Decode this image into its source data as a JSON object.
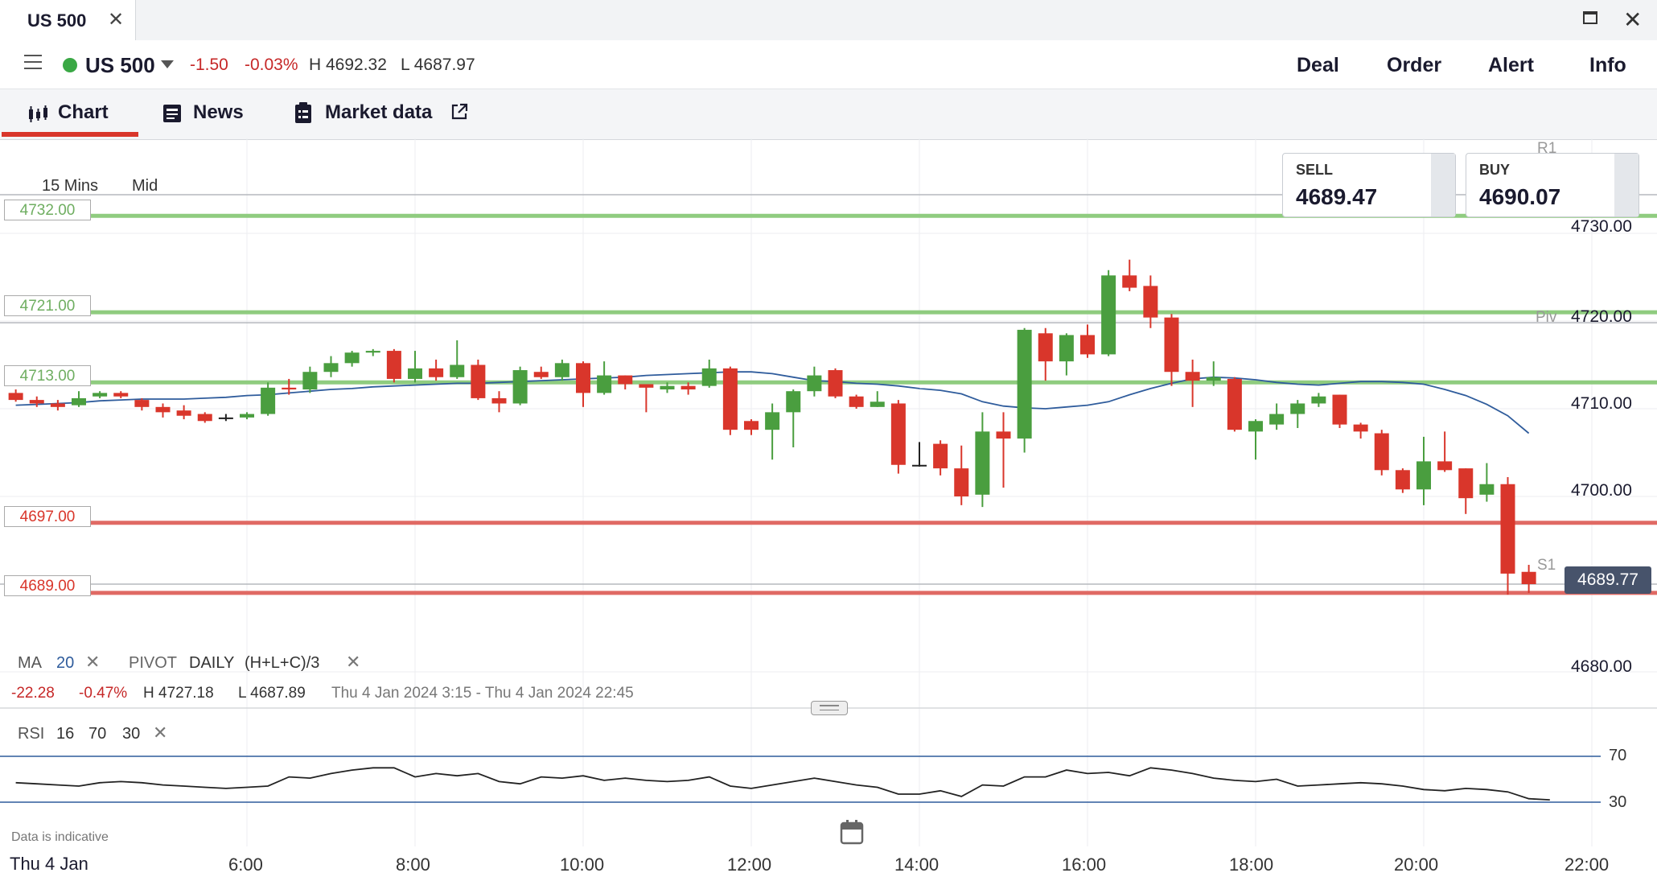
{
  "window": {
    "tab_title": "US 500"
  },
  "header": {
    "market": "US 500",
    "change": "-1.50",
    "change_pct": "-0.03%",
    "high": "H 4692.32",
    "low": "L 4687.97",
    "actions": [
      "Deal",
      "Order",
      "Alert",
      "Info"
    ]
  },
  "subtabs": {
    "chart": "Chart",
    "news": "News",
    "market_data": "Market data"
  },
  "chart": {
    "timeframe": "15 Mins",
    "price_type": "Mid",
    "sell_label": "SELL",
    "sell_price": "4689.47",
    "buy_label": "BUY",
    "buy_price": "4690.07",
    "current_price": "4689.77",
    "level_labels": [
      "4732.00",
      "4721.00",
      "4713.00",
      "4697.00",
      "4689.00"
    ],
    "pivot_labels": {
      "r1": "R1",
      "piv": "Piv",
      "s1": "S1"
    }
  },
  "legend": {
    "ma": "MA",
    "ma_period": "20",
    "pivot": "PIVOT",
    "pivot_period": "DAILY",
    "pivot_formula": "(H+L+C)/3",
    "range_change": "-22.28",
    "range_change_pct": "-0.47%",
    "range_high": "H 4727.18",
    "range_low": "L 4687.89",
    "range_dates": "Thu 4 Jan 2024 3:15 - Thu 4 Jan 2024 22:45",
    "rsi": "RSI",
    "rsi_period": "16",
    "rsi_upper": "70",
    "rsi_lower": "30"
  },
  "footer": {
    "date_start": "Thu 4 Jan",
    "indicative": "Data is indicative"
  },
  "colors": {
    "up": "#4a9e3f",
    "down": "#d9362b",
    "ma": "#2f5c9c",
    "support": "#e06a64",
    "resistance": "#8fcc7f"
  },
  "chart_data": {
    "type": "candlestick",
    "ylim": [
      4676,
      4738
    ],
    "y_ticks": [
      "4680.00",
      "4690.00",
      "4700.00",
      "4710.00",
      "4720.00",
      "4730.00"
    ],
    "x_ticks": [
      "6:00",
      "8:00",
      "10:00",
      "12:00",
      "14:00",
      "16:00",
      "18:00",
      "20:00",
      "22:00"
    ],
    "horizontal_levels": {
      "resistance": [
        4732,
        4721,
        4713
      ],
      "support": [
        4697,
        4689
      ],
      "pivot": {
        "R1": 4734.4,
        "Piv": 4719.8,
        "S1": 4690
      }
    },
    "candles": [
      {
        "o": 4711.8,
        "c": 4711.0,
        "h": 4712.2,
        "l": 4710.8
      },
      {
        "o": 4711.0,
        "c": 4710.6,
        "h": 4711.4,
        "l": 4710.2
      },
      {
        "o": 4710.6,
        "c": 4710.2,
        "h": 4711.0,
        "l": 4709.8
      },
      {
        "o": 4710.4,
        "c": 4711.2,
        "h": 4712.0,
        "l": 4710.2
      },
      {
        "o": 4711.4,
        "c": 4711.8,
        "h": 4712.0,
        "l": 4711.2
      },
      {
        "o": 4711.8,
        "c": 4711.4,
        "h": 4712.0,
        "l": 4711.2
      },
      {
        "o": 4711.0,
        "c": 4710.2,
        "h": 4711.2,
        "l": 4709.8
      },
      {
        "o": 4710.2,
        "c": 4709.6,
        "h": 4710.6,
        "l": 4709.0
      },
      {
        "o": 4709.8,
        "c": 4709.2,
        "h": 4710.4,
        "l": 4708.8
      },
      {
        "o": 4709.4,
        "c": 4708.6,
        "h": 4709.6,
        "l": 4708.4
      },
      {
        "o": 4709.0,
        "c": 4709.0,
        "h": 4709.4,
        "l": 4708.6
      },
      {
        "o": 4709.0,
        "c": 4709.4,
        "h": 4709.6,
        "l": 4708.8
      },
      {
        "o": 4709.4,
        "c": 4712.4,
        "h": 4713.0,
        "l": 4709.2
      },
      {
        "o": 4712.4,
        "c": 4712.2,
        "h": 4713.4,
        "l": 4711.6
      },
      {
        "o": 4712.2,
        "c": 4714.2,
        "h": 4714.8,
        "l": 4711.8
      },
      {
        "o": 4714.2,
        "c": 4715.2,
        "h": 4716.0,
        "l": 4713.6
      },
      {
        "o": 4715.2,
        "c": 4716.4,
        "h": 4716.6,
        "l": 4714.8
      },
      {
        "o": 4716.4,
        "c": 4716.6,
        "h": 4716.8,
        "l": 4716.0
      },
      {
        "o": 4716.6,
        "c": 4713.4,
        "h": 4716.8,
        "l": 4713.0
      },
      {
        "o": 4713.4,
        "c": 4714.6,
        "h": 4716.6,
        "l": 4713.0
      },
      {
        "o": 4714.6,
        "c": 4713.6,
        "h": 4715.6,
        "l": 4713.2
      },
      {
        "o": 4713.6,
        "c": 4715.0,
        "h": 4717.8,
        "l": 4713.4
      },
      {
        "o": 4715.0,
        "c": 4711.2,
        "h": 4715.6,
        "l": 4711.0
      },
      {
        "o": 4711.2,
        "c": 4710.6,
        "h": 4712.0,
        "l": 4709.6
      },
      {
        "o": 4710.6,
        "c": 4714.4,
        "h": 4714.8,
        "l": 4710.4
      },
      {
        "o": 4714.2,
        "c": 4713.6,
        "h": 4714.8,
        "l": 4713.4
      },
      {
        "o": 4713.6,
        "c": 4715.2,
        "h": 4715.6,
        "l": 4713.2
      },
      {
        "o": 4715.2,
        "c": 4711.8,
        "h": 4715.4,
        "l": 4710.2
      },
      {
        "o": 4711.8,
        "c": 4713.8,
        "h": 4715.4,
        "l": 4711.6
      },
      {
        "o": 4713.8,
        "c": 4712.8,
        "h": 4713.8,
        "l": 4712.2
      },
      {
        "o": 4712.8,
        "c": 4712.4,
        "h": 4712.6,
        "l": 4709.6
      },
      {
        "o": 4712.2,
        "c": 4712.6,
        "h": 4713.0,
        "l": 4711.8
      },
      {
        "o": 4712.6,
        "c": 4712.2,
        "h": 4713.0,
        "l": 4711.6
      },
      {
        "o": 4712.6,
        "c": 4714.6,
        "h": 4715.6,
        "l": 4712.4
      },
      {
        "o": 4714.6,
        "c": 4707.6,
        "h": 4714.8,
        "l": 4707.0
      },
      {
        "o": 4708.6,
        "c": 4707.6,
        "h": 4708.8,
        "l": 4707.0
      },
      {
        "o": 4707.6,
        "c": 4709.6,
        "h": 4710.6,
        "l": 4704.2
      },
      {
        "o": 4709.6,
        "c": 4712.0,
        "h": 4712.2,
        "l": 4705.6
      },
      {
        "o": 4712.0,
        "c": 4713.8,
        "h": 4714.8,
        "l": 4711.4
      },
      {
        "o": 4714.4,
        "c": 4711.4,
        "h": 4714.6,
        "l": 4711.2
      },
      {
        "o": 4711.4,
        "c": 4710.2,
        "h": 4711.6,
        "l": 4710.0
      },
      {
        "o": 4710.2,
        "c": 4710.8,
        "h": 4712.0,
        "l": 4710.2
      },
      {
        "o": 4710.6,
        "c": 4703.6,
        "h": 4711.0,
        "l": 4702.6
      },
      {
        "o": 4703.6,
        "c": 4703.6,
        "h": 4706.2,
        "l": 4703.4
      },
      {
        "o": 4706.0,
        "c": 4703.2,
        "h": 4706.4,
        "l": 4702.4
      },
      {
        "o": 4703.2,
        "c": 4700.0,
        "h": 4705.8,
        "l": 4699.0
      },
      {
        "o": 4700.2,
        "c": 4707.4,
        "h": 4709.6,
        "l": 4698.8
      },
      {
        "o": 4707.4,
        "c": 4706.6,
        "h": 4709.6,
        "l": 4701.0
      },
      {
        "o": 4706.6,
        "c": 4719.0,
        "h": 4719.2,
        "l": 4705.0
      },
      {
        "o": 4718.6,
        "c": 4715.4,
        "h": 4719.2,
        "l": 4713.2
      },
      {
        "o": 4715.4,
        "c": 4718.4,
        "h": 4718.6,
        "l": 4713.8
      },
      {
        "o": 4718.4,
        "c": 4716.2,
        "h": 4719.6,
        "l": 4715.8
      },
      {
        "o": 4716.2,
        "c": 4725.2,
        "h": 4725.8,
        "l": 4716.0
      },
      {
        "o": 4725.2,
        "c": 4723.8,
        "h": 4727.0,
        "l": 4723.4
      },
      {
        "o": 4724.0,
        "c": 4720.4,
        "h": 4725.2,
        "l": 4719.2
      },
      {
        "o": 4720.4,
        "c": 4714.2,
        "h": 4720.8,
        "l": 4712.6
      },
      {
        "o": 4714.2,
        "c": 4713.2,
        "h": 4715.6,
        "l": 4710.2
      },
      {
        "o": 4713.2,
        "c": 4713.6,
        "h": 4715.4,
        "l": 4712.6
      },
      {
        "o": 4713.4,
        "c": 4707.6,
        "h": 4713.6,
        "l": 4707.4
      },
      {
        "o": 4707.4,
        "c": 4708.6,
        "h": 4708.8,
        "l": 4704.2
      },
      {
        "o": 4708.2,
        "c": 4709.4,
        "h": 4710.6,
        "l": 4707.6
      },
      {
        "o": 4709.4,
        "c": 4710.6,
        "h": 4711.0,
        "l": 4707.8
      },
      {
        "o": 4710.6,
        "c": 4711.4,
        "h": 4711.8,
        "l": 4710.2
      },
      {
        "o": 4711.6,
        "c": 4708.2,
        "h": 4711.6,
        "l": 4707.8
      },
      {
        "o": 4708.2,
        "c": 4707.4,
        "h": 4708.4,
        "l": 4706.6
      },
      {
        "o": 4707.2,
        "c": 4703.0,
        "h": 4707.6,
        "l": 4702.4
      },
      {
        "o": 4703.0,
        "c": 4700.8,
        "h": 4703.2,
        "l": 4700.4
      },
      {
        "o": 4700.8,
        "c": 4704.0,
        "h": 4706.8,
        "l": 4699.0
      },
      {
        "o": 4704.0,
        "c": 4703.0,
        "h": 4707.4,
        "l": 4702.8
      },
      {
        "o": 4703.2,
        "c": 4699.8,
        "h": 4703.2,
        "l": 4698.0
      },
      {
        "o": 4700.2,
        "c": 4701.4,
        "h": 4703.8,
        "l": 4699.4
      },
      {
        "o": 4701.4,
        "c": 4691.2,
        "h": 4702.2,
        "l": 4688.8
      },
      {
        "o": 4691.4,
        "c": 4690.0,
        "h": 4692.2,
        "l": 4689.0
      }
    ],
    "ma_values": [
      4710.4,
      4710.5,
      4710.6,
      4710.7,
      4710.9,
      4711.0,
      4711.1,
      4711.1,
      4711.1,
      4711.2,
      4711.3,
      4711.5,
      4711.6,
      4711.8,
      4712.0,
      4712.2,
      4712.3,
      4712.5,
      4712.6,
      4712.7,
      4712.8,
      4712.9,
      4712.9,
      4713.0,
      4713.1,
      4713.2,
      4713.3,
      4713.4,
      4713.5,
      4713.6,
      4713.8,
      4713.9,
      4714.0,
      4714.1,
      4714.2,
      4714.2,
      4714.0,
      4713.6,
      4713.2,
      4713.1,
      4712.9,
      4712.8,
      4712.6,
      4712.3,
      4712.1,
      4711.7,
      4710.8,
      4710.3,
      4710.1,
      4710.0,
      4710.2,
      4710.4,
      4710.8,
      4711.6,
      4712.3,
      4712.9,
      4713.4,
      4713.6,
      4713.5,
      4713.3,
      4713.0,
      4712.8,
      4712.7,
      4712.9,
      4713.1,
      4713.1,
      4713.0,
      4712.8,
      4712.2,
      4711.5,
      4710.5,
      4709.2,
      4707.2
    ],
    "rsi": {
      "ylim": [
        20,
        80
      ],
      "levels": [
        70,
        30
      ],
      "values": [
        47,
        46,
        45,
        44,
        47,
        48,
        47,
        45,
        44,
        43,
        42,
        43,
        44,
        52,
        51,
        55,
        58,
        60,
        60,
        52,
        55,
        53,
        55,
        48,
        46,
        52,
        51,
        53,
        49,
        51,
        49,
        48,
        49,
        52,
        44,
        42,
        45,
        48,
        51,
        48,
        45,
        43,
        37,
        37,
        40,
        35,
        45,
        44,
        52,
        52,
        58,
        55,
        56,
        53,
        60,
        58,
        55,
        51,
        49,
        48,
        50,
        44,
        45,
        46,
        47,
        46,
        44,
        41,
        40,
        42,
        41,
        39,
        33,
        32
      ]
    }
  }
}
